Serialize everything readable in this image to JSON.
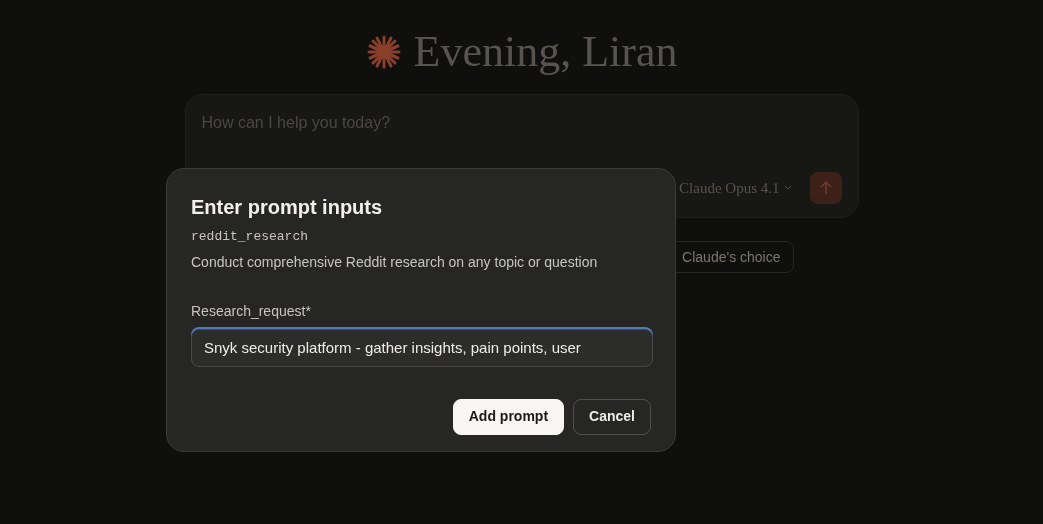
{
  "greeting": "Evening, Liran",
  "composer": {
    "placeholder": "How can I help you today?",
    "model": "Claude Opus 4.1"
  },
  "chips": [
    "Claude's choice"
  ],
  "dialog": {
    "title": "Enter prompt inputs",
    "prompt_name": "reddit_research",
    "description": "Conduct comprehensive Reddit research on any topic or question",
    "field": {
      "label": "Research_request*",
      "value": "Snyk security platform - gather insights, pain points, user",
      "focused": true
    },
    "buttons": [
      {
        "label": "Add prompt",
        "kind": "primary"
      },
      {
        "label": "Cancel",
        "kind": "secondary"
      }
    ]
  }
}
